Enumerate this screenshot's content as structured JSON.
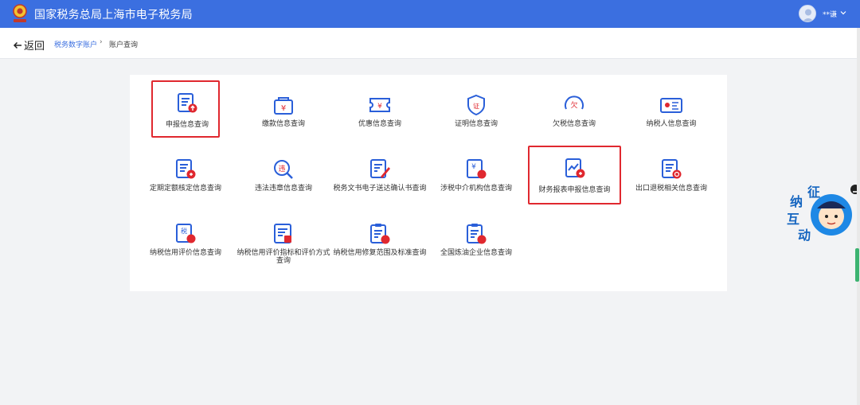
{
  "header": {
    "title": "国家税务总局上海市电子税务局",
    "user_name": "**谦",
    "logo_icon": "tax-emblem-icon",
    "colors": {
      "bar": "#3b6fe0",
      "accent": "#e0282f"
    }
  },
  "breadcrumb": {
    "back_label": "返回",
    "root": "税务数字账户",
    "separator": "›",
    "current": "账户查询"
  },
  "tiles": [
    {
      "label": "申报信息查询",
      "icon": "declaration-info-icon",
      "highlighted": true
    },
    {
      "label": "缴款信息查询",
      "icon": "payment-info-icon"
    },
    {
      "label": "优惠信息查询",
      "icon": "discount-info-icon"
    },
    {
      "label": "证明信息查询",
      "icon": "certificate-info-icon"
    },
    {
      "label": "欠税信息查询",
      "icon": "tax-arrears-icon"
    },
    {
      "label": "纳税人信息查询",
      "icon": "taxpayer-info-icon"
    },
    {
      "label": "定期定额核定信息查询",
      "icon": "fixed-quota-icon"
    },
    {
      "label": "违法违章信息查询",
      "icon": "violation-info-icon"
    },
    {
      "label": "税务文书电子送达确认书查询",
      "icon": "e-document-icon"
    },
    {
      "label": "涉税中介机构信息查询",
      "icon": "tax-agency-icon"
    },
    {
      "label": "财务报表申报信息查询",
      "icon": "financial-report-icon",
      "highlighted": true
    },
    {
      "label": "出口退税相关信息查询",
      "icon": "export-rebate-icon"
    },
    {
      "label": "纳税信用评价信息查询",
      "icon": "credit-rating-icon"
    },
    {
      "label": "纳税信用评价指标和评价方式查询",
      "icon": "credit-indicator-icon"
    },
    {
      "label": "纳税信用修复范围及标准查询",
      "icon": "credit-repair-icon"
    },
    {
      "label": "全国炼油企业信息查询",
      "icon": "refinery-info-icon"
    }
  ],
  "side_badge": {
    "chars": [
      "征",
      "纳",
      "互",
      "动"
    ],
    "icon": "tax-officer-mascot-icon"
  }
}
